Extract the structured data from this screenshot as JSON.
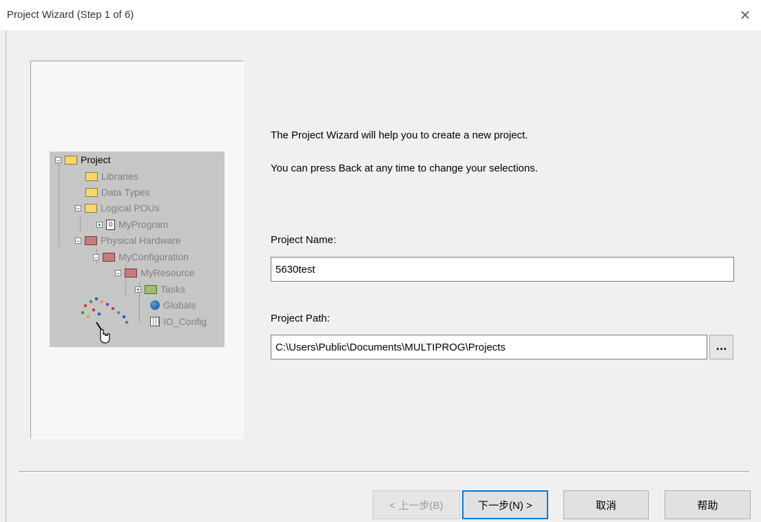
{
  "window": {
    "title": "Project Wizard (Step 1 of 6)",
    "close_symbol": "✕"
  },
  "tree": {
    "root": "Project",
    "libraries": "Libraries",
    "data_types": "Data Types",
    "logical_pous": "Logical POUs",
    "my_program": "MyProgram",
    "physical_hardware": "Physical Hardware",
    "my_configuration": "MyConfiguration",
    "my_resource": "MyResource",
    "tasks": "Tasks",
    "globals": "Globals",
    "io_config": "IO_Config"
  },
  "intro": {
    "line1": "The Project Wizard will help you to create a new project.",
    "line2": "You can press Back at any time to change your selections."
  },
  "project_name": {
    "label": "Project Name:",
    "value": "5630test"
  },
  "project_path": {
    "label": "Project Path:",
    "value": "C:\\Users\\Public\\Documents\\MULTIPROG\\Projects",
    "browse_label": "..."
  },
  "buttons": {
    "back": "< 上一步(B)",
    "next": "下一步(N) >",
    "cancel": "取消",
    "help": "帮助"
  },
  "colors": {
    "dialog_bg": "#f0f0f0",
    "illustration_bg": "#c6c6c6",
    "default_button_border": "#0078d7"
  }
}
